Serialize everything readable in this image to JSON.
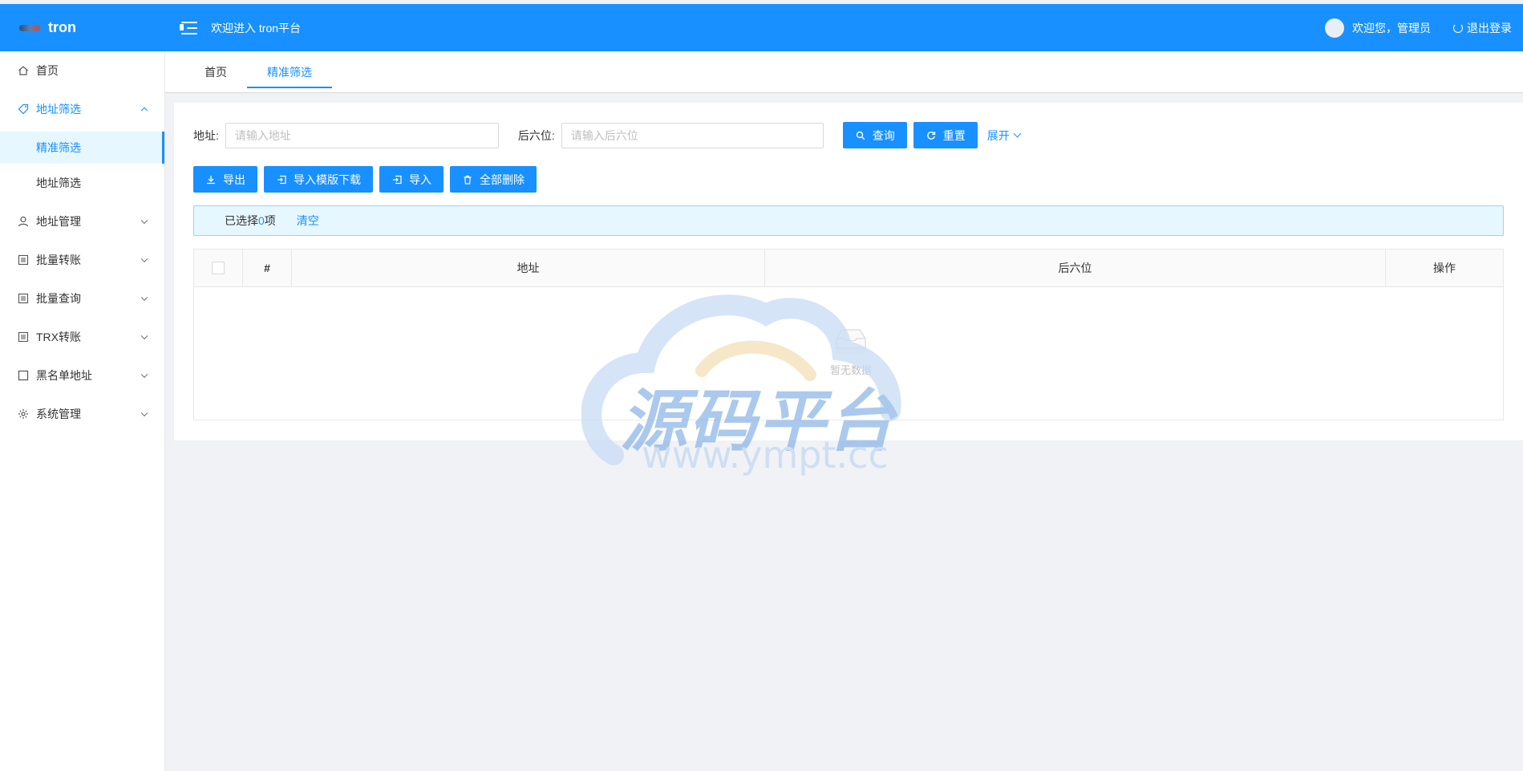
{
  "app": {
    "logo_text": "tron",
    "welcome": "欢迎进入 tron平台",
    "user_greeting": "欢迎您，管理员",
    "logout": "退出登录",
    "accent_color": "#1890ff"
  },
  "sidebar": {
    "items": [
      {
        "label": "首页",
        "icon": "home-icon"
      },
      {
        "label": "地址筛选",
        "icon": "tag-icon",
        "expanded": true,
        "children": [
          {
            "label": "精准筛选",
            "active": true
          },
          {
            "label": "地址筛选",
            "active": false
          }
        ]
      },
      {
        "label": "地址管理",
        "icon": "user-icon"
      },
      {
        "label": "批量转账",
        "icon": "list-icon"
      },
      {
        "label": "批量查询",
        "icon": "list-icon"
      },
      {
        "label": "TRX转账",
        "icon": "list-icon"
      },
      {
        "label": "黑名单地址",
        "icon": "square-icon"
      },
      {
        "label": "系统管理",
        "icon": "gear-icon"
      }
    ]
  },
  "tabs": [
    {
      "label": "首页",
      "active": false
    },
    {
      "label": "精准筛选",
      "active": true
    }
  ],
  "search": {
    "address_label": "地址:",
    "address_placeholder": "请输入地址",
    "suffix_label": "后六位:",
    "suffix_placeholder": "请输入后六位",
    "query_button": "查询",
    "reset_button": "重置",
    "expand_link": "展开"
  },
  "actions": {
    "export": "导出",
    "template_download": "导入模版下载",
    "import": "导入",
    "delete_all": "全部删除"
  },
  "selection": {
    "prefix": "已选择 ",
    "count": "0",
    "suffix": "项",
    "clear": "清空"
  },
  "table": {
    "columns": [
      "#",
      "地址",
      "后六位",
      "操作"
    ],
    "empty_text": "暂无数据"
  },
  "watermark": {
    "main": "源码平台",
    "url": "www.ympt.cc"
  }
}
